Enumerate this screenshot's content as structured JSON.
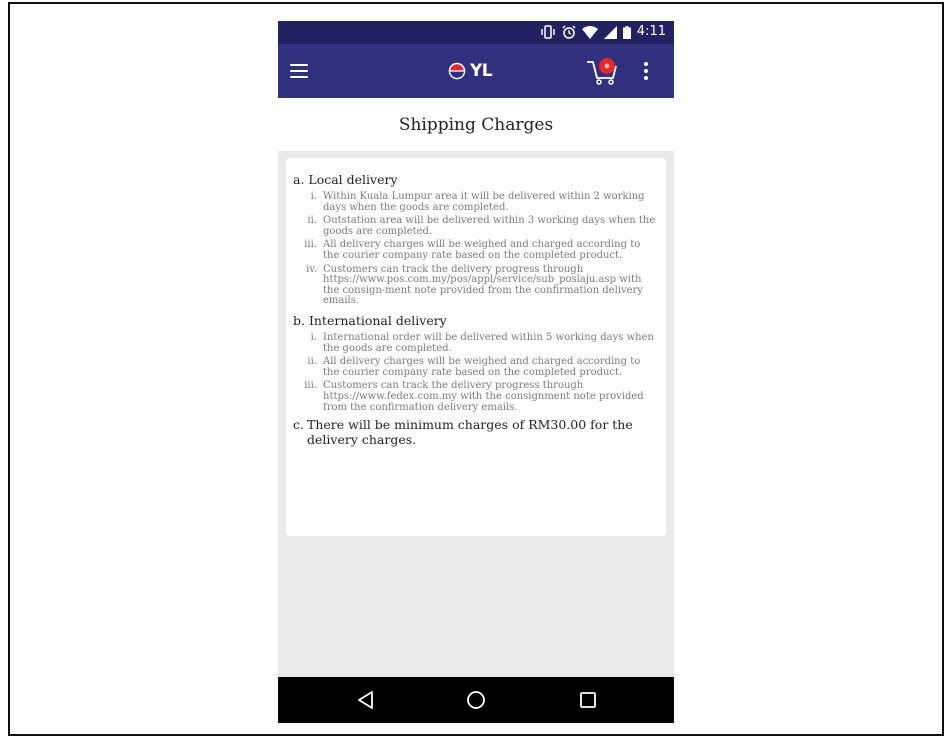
{
  "status_bar": {
    "time": "4:11",
    "icons": [
      "vibrate-icon",
      "alarm-icon",
      "wifi-icon",
      "signal-icon",
      "battery-icon"
    ]
  },
  "app_bar": {
    "logo_text": "YL",
    "menu_icon": "hamburger-menu-icon",
    "cart_icon": "shopping-cart-icon",
    "more_icon": "more-vert-icon",
    "color": "#30307f",
    "status_color": "#232260"
  },
  "page": {
    "title": "Shipping Charges"
  },
  "content": {
    "local": {
      "heading": "a. Local delivery",
      "items": [
        {
          "num": "i.",
          "text": "Within Kuala Lumpur area it will be delivered within 2 working days when the goods are completed."
        },
        {
          "num": "ii.",
          "text": "Outstation area will be delivered within 3 working days when the goods are completed."
        },
        {
          "num": "iii.",
          "text": "All delivery charges will be weighed and charged according to the courier company rate based on the completed product."
        },
        {
          "num": "iv.",
          "text": "Customers can track the delivery progress through https://www.pos.com.my/pos/appl/service/sub_poslaju.asp with the consign-ment note provided from the confirmation delivery emails."
        }
      ]
    },
    "international": {
      "heading": "b. International delivery",
      "items": [
        {
          "num": "i.",
          "text": "International order will be delivered within 5 working days when the goods are completed."
        },
        {
          "num": "ii.",
          "text": "All delivery charges will be weighed and charged according to the courier company rate based on the completed product."
        },
        {
          "num": "iii.",
          "text": "Customers can track the delivery progress through https://www.fedex.com.my with the consignment note provided from the confirmation delivery emails."
        }
      ]
    },
    "minimum": {
      "label": "c.",
      "text": "There will be minimum charges of RM30.00 for the delivery charges."
    }
  },
  "nav_bar": {
    "back_icon": "back-triangle-icon",
    "home_icon": "home-circle-icon",
    "recents_icon": "recents-square-icon"
  }
}
